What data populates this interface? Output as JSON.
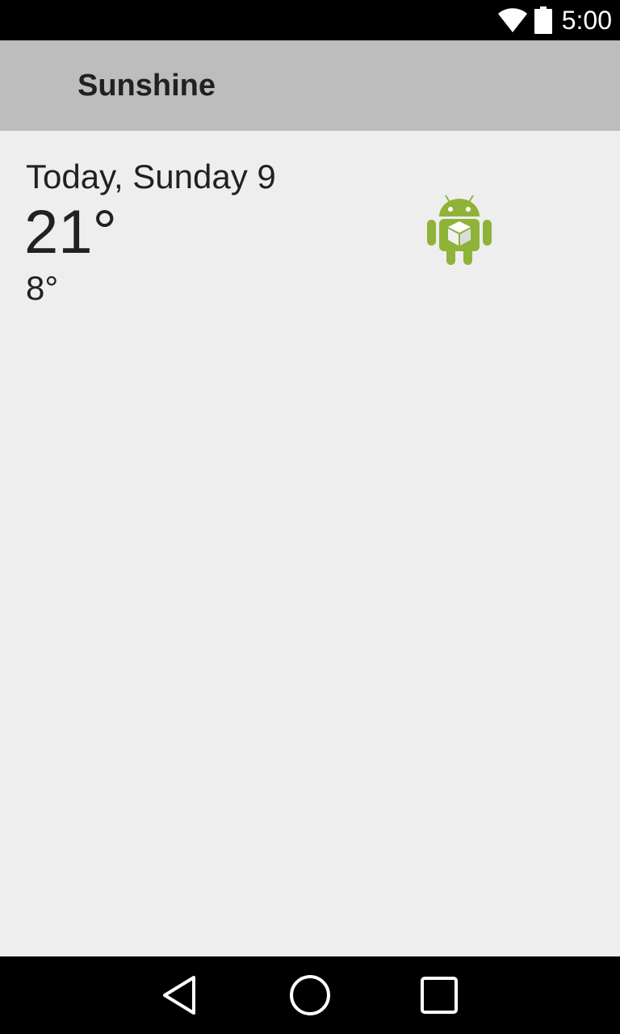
{
  "status_bar": {
    "time": "5:00",
    "icons": [
      "wifi-icon",
      "battery-icon"
    ]
  },
  "app_bar": {
    "title": "Sunshine"
  },
  "today": {
    "day_label": "Today, Sunday 9",
    "high": "21°",
    "low": "8°",
    "icon": "android-placeholder-icon"
  },
  "nav_bar": {
    "buttons": [
      "back-icon",
      "home-icon",
      "recents-icon"
    ]
  },
  "colors": {
    "status_bar": "#000000",
    "app_bar": "#bdbdbd",
    "background": "#eeeeee",
    "text": "#212121",
    "android_green": "#8fb339"
  }
}
